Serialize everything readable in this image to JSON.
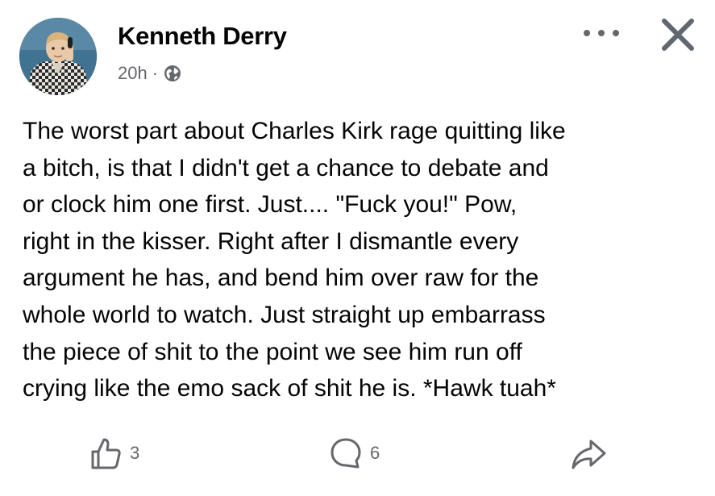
{
  "post": {
    "author_name": "Kenneth Derry",
    "timestamp": "20h",
    "separator": "·",
    "privacy_icon": "globe-icon",
    "avatar_icon": "profile-photo",
    "body_text": "The worst part about Charles Kirk rage quitting like\na bitch, is that I didn't get a chance to debate and\nor clock him one first. Just.... \"Fuck you!\" Pow,\nright in the kisser. Right after I dismantle every\nargument he has, and bend him over raw for the\nwhole world to watch. Just straight up embarrass\nthe piece of shit to the point we see him run off\ncrying like the emo sack of shit he is. *Hawk tuah*"
  },
  "header_actions": {
    "more_icon": "more-options-icon",
    "close_icon": "close-icon"
  },
  "footer": {
    "like_count": "3",
    "comment_count": "6",
    "like_icon": "thumbs-up-icon",
    "comment_icon": "comment-bubble-icon",
    "share_icon": "share-arrow-icon"
  },
  "colors": {
    "primary_text": "#050505",
    "secondary_text": "#65676b",
    "background": "#ffffff"
  }
}
